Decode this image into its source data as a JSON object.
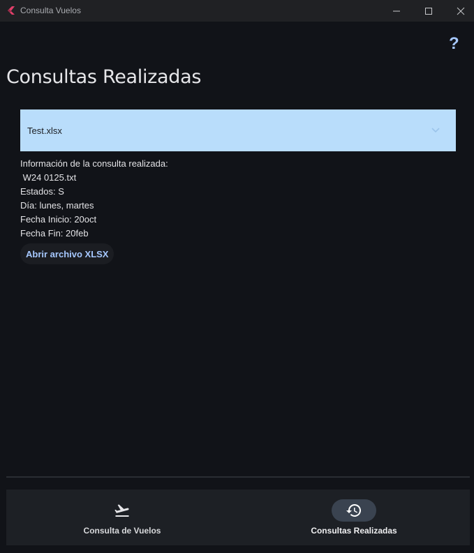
{
  "window": {
    "title": "Consulta Vuelos"
  },
  "page": {
    "title": "Consultas Realizadas",
    "help_symbol": "?"
  },
  "dropdown": {
    "selected": "Test.xlsx"
  },
  "info": {
    "heading": "Información de la consulta realizada:",
    "file": " W24 0125.txt",
    "estados": "Estados: S",
    "dia": "Día: lunes, martes",
    "fecha_inicio": "Fecha Inicio: 20oct",
    "fecha_fin": "Fecha Fin: 20feb"
  },
  "actions": {
    "open_xlsx_label": "Abrir archivo XLSX"
  },
  "bottom_nav": {
    "items": [
      {
        "label": "Consulta de Vuelos",
        "icon": "flight-takeoff-icon",
        "selected": false
      },
      {
        "label": "Consultas Realizadas",
        "icon": "history-icon",
        "selected": true
      }
    ]
  },
  "colors": {
    "background": "#111318",
    "accent": "#a6c8ff",
    "dropdown_bg": "#b9ddfb",
    "nav_bg": "#1d2025",
    "nav_selected_pill": "#3a4350"
  }
}
